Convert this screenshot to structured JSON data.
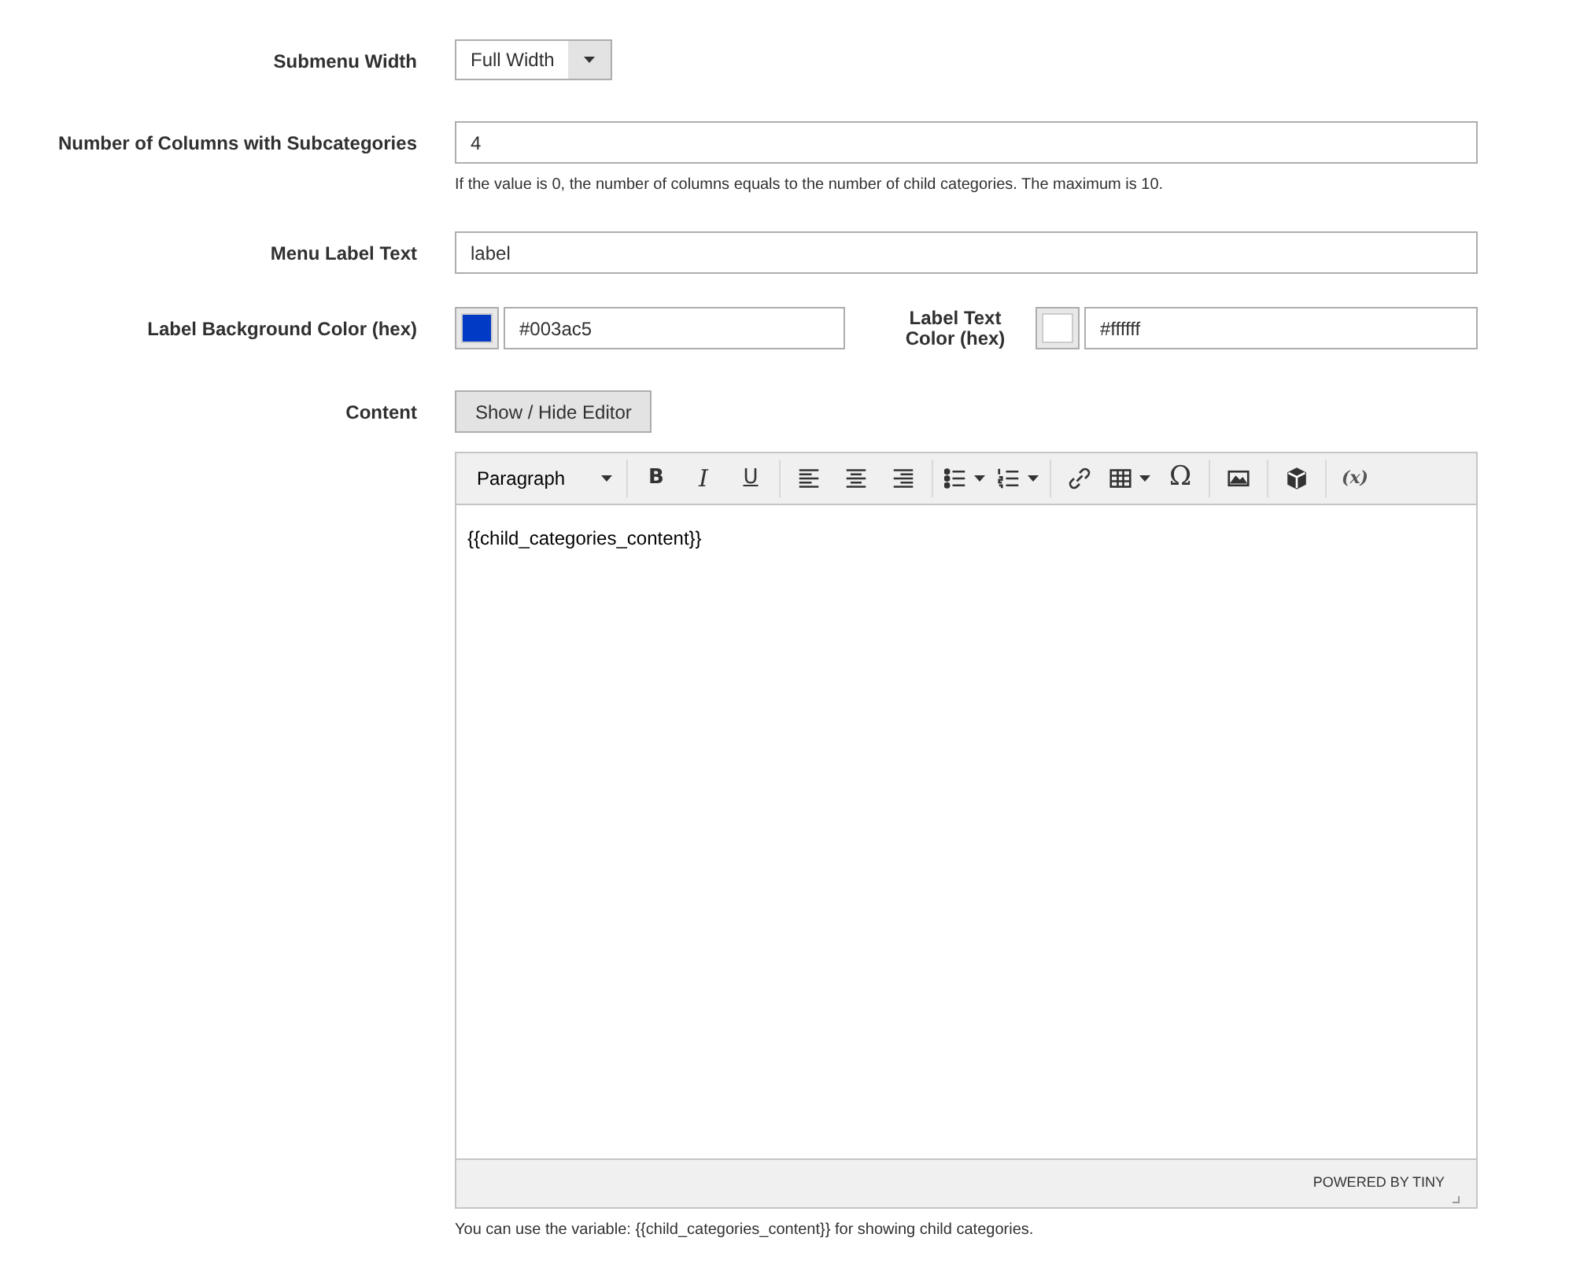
{
  "fields": [
    {
      "kind": "select",
      "label": "Submenu Width",
      "value": "Full Width"
    },
    {
      "kind": "text",
      "label": "Number of Columns with Subcategories",
      "value": "4",
      "note": "If the value is 0, the number of columns equals to the number of child categories. The maximum is 10."
    },
    {
      "kind": "text",
      "label": "Menu Label Text",
      "value": "label"
    },
    {
      "kind": "colors",
      "label": "Label Background Color (hex)",
      "value": "#003ac5",
      "second_label": "Label Text Color (hex)",
      "second_value": "#ffffff"
    },
    {
      "kind": "editor",
      "label": "Content",
      "toggle": "Show / Hide Editor",
      "format": "Paragraph",
      "content": "{{child_categories_content}}",
      "branding": "POWERED BY TINY",
      "note": "You can use the variable: {{child_categories_content}} for showing child categories."
    }
  ],
  "toolbar": [
    [
      {
        "kind": "bold",
        "label": "B"
      },
      {
        "kind": "italic",
        "label": "I"
      },
      {
        "kind": "underline",
        "label": "U"
      }
    ],
    [
      {
        "kind": "align-left"
      },
      {
        "kind": "align-center"
      },
      {
        "kind": "align-right"
      }
    ],
    [
      {
        "kind": "bullets"
      },
      {
        "kind": "numbers"
      }
    ],
    [
      {
        "kind": "link"
      },
      {
        "kind": "table"
      },
      {
        "kind": "text",
        "label": "Ω"
      }
    ],
    [
      {
        "kind": "image"
      }
    ],
    [
      {
        "kind": "widget"
      }
    ],
    [
      {
        "kind": "variable",
        "label": "(x)"
      }
    ]
  ]
}
